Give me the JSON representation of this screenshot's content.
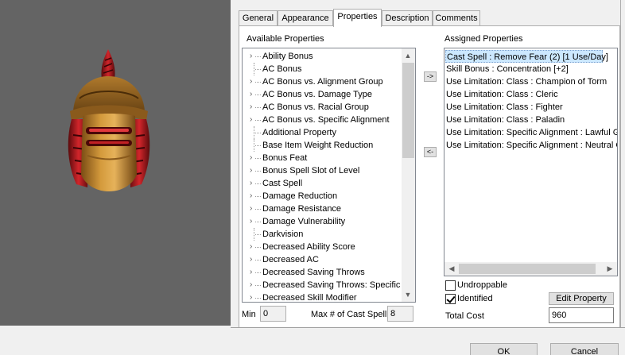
{
  "tabs": [
    {
      "label": "General"
    },
    {
      "label": "Appearance"
    },
    {
      "label": "Properties"
    },
    {
      "label": "Description"
    },
    {
      "label": "Comments"
    }
  ],
  "available": {
    "label": "Available Properties",
    "items": [
      {
        "label": "Ability Bonus",
        "expandable": true
      },
      {
        "label": "AC Bonus",
        "expandable": false
      },
      {
        "label": "AC Bonus vs. Alignment Group",
        "expandable": true
      },
      {
        "label": "AC Bonus vs. Damage Type",
        "expandable": true
      },
      {
        "label": "AC Bonus vs. Racial Group",
        "expandable": true
      },
      {
        "label": "AC Bonus vs. Specific Alignment",
        "expandable": true
      },
      {
        "label": "Additional Property",
        "expandable": false
      },
      {
        "label": "Base Item Weight Reduction",
        "expandable": false
      },
      {
        "label": "Bonus Feat",
        "expandable": true
      },
      {
        "label": "Bonus Spell Slot of Level",
        "expandable": true
      },
      {
        "label": "Cast Spell",
        "expandable": true
      },
      {
        "label": "Damage Reduction",
        "expandable": true
      },
      {
        "label": "Damage Resistance",
        "expandable": true
      },
      {
        "label": "Damage Vulnerability",
        "expandable": true
      },
      {
        "label": "Darkvision",
        "expandable": false
      },
      {
        "label": "Decreased Ability Score",
        "expandable": true
      },
      {
        "label": "Decreased AC",
        "expandable": true
      },
      {
        "label": "Decreased Saving Throws",
        "expandable": true
      },
      {
        "label": "Decreased Saving Throws: Specific",
        "expandable": true
      },
      {
        "label": "Decreased Skill Modifier",
        "expandable": true
      }
    ]
  },
  "assigned": {
    "label": "Assigned Properties",
    "items": [
      {
        "label": "Cast Spell : Remove Fear (2) [1 Use/Day]",
        "selected": true
      },
      {
        "label": "Skill Bonus : Concentration [+2]",
        "selected": false
      },
      {
        "label": "Use Limitation: Class : Champion of Torm",
        "selected": false
      },
      {
        "label": "Use Limitation: Class : Cleric",
        "selected": false
      },
      {
        "label": "Use Limitation: Class : Fighter",
        "selected": false
      },
      {
        "label": "Use Limitation: Class : Paladin",
        "selected": false
      },
      {
        "label": "Use Limitation: Specific Alignment : Lawful Go",
        "selected": false
      },
      {
        "label": "Use Limitation: Specific Alignment : Neutral Go",
        "selected": false
      }
    ]
  },
  "buttons": {
    "add": "->",
    "remove": "<-",
    "edit_property": "Edit Property",
    "ok": "OK",
    "cancel": "Cancel"
  },
  "options": {
    "undroppable": {
      "label": "Undroppable",
      "checked": false
    },
    "identified": {
      "label": "Identified",
      "checked": true
    }
  },
  "fields": {
    "min_label": "Min",
    "min_value": "0",
    "max_label": "Max # of Cast Spell",
    "max_value": "8",
    "total_cost_label": "Total Cost",
    "total_cost_value": "960"
  },
  "colors": {
    "preview_bg": "#646464",
    "selection_bg": "#cce8ff",
    "helmet_gold": "#c7892e",
    "plume_red": "#c0151c"
  }
}
